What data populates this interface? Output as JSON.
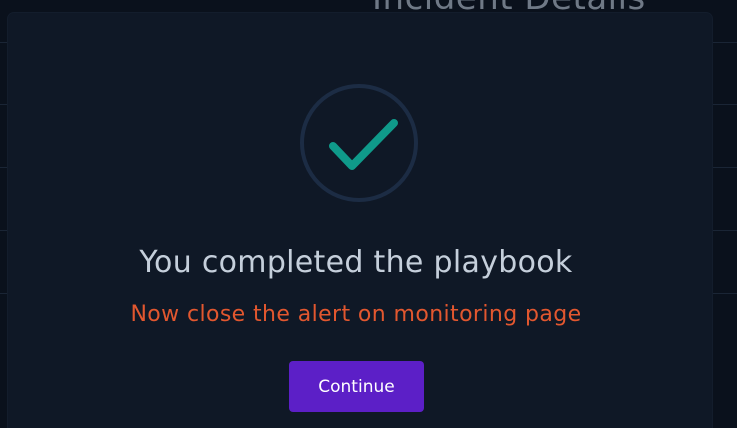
{
  "background": {
    "page_title": "Incident Details"
  },
  "modal": {
    "icon": "check-icon",
    "title": "You completed the playbook",
    "subtitle": "Now close the alert on monitoring page",
    "continue_label": "Continue"
  },
  "colors": {
    "page_background": "#0a111c",
    "modal_background": "#0f1826",
    "check": "#0f9a8a",
    "ring": "#1c2c44",
    "subtitle": "#e2572f",
    "button": "#5c1fc7"
  }
}
